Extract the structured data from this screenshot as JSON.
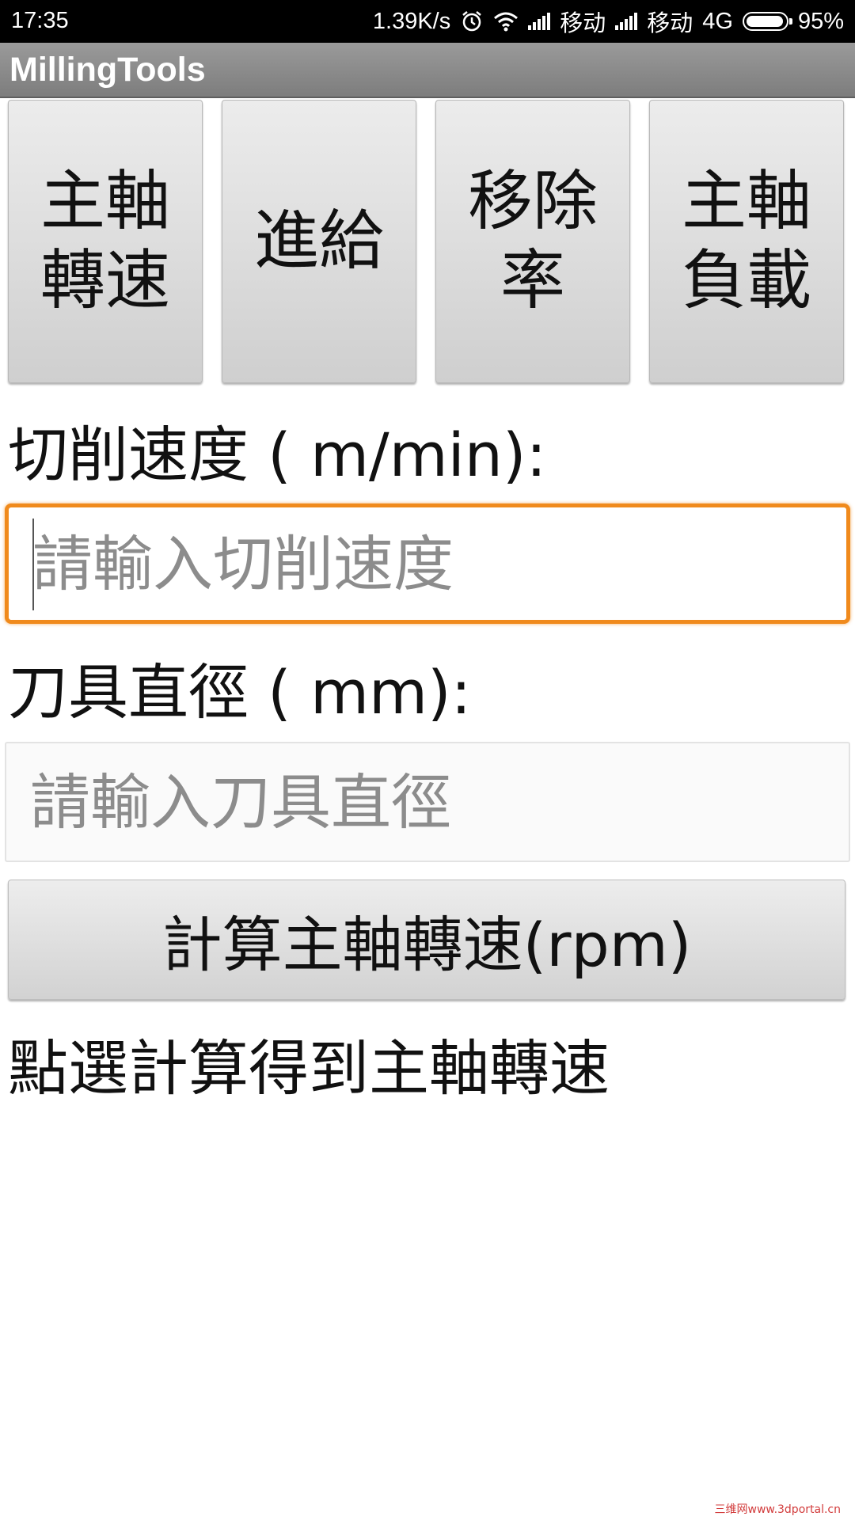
{
  "status_bar": {
    "time": "17:35",
    "net_speed": "1.39K/s",
    "carrier_1": "移动",
    "carrier_2": "移动",
    "network_type": "4G",
    "battery": "95%",
    "battery_level": 0.95
  },
  "app": {
    "title": "MillingTools"
  },
  "modes": [
    {
      "label": "主軸轉速"
    },
    {
      "label": "進給"
    },
    {
      "label": "移除率"
    },
    {
      "label": "主軸負載"
    }
  ],
  "cutting_speed": {
    "label": "切削速度 ( m/min):",
    "placeholder": "請輸入切削速度",
    "value": ""
  },
  "tool_diameter": {
    "label": "刀具直徑 ( mm):",
    "placeholder": "請輸入刀具直徑",
    "value": ""
  },
  "calculate_button": {
    "label": "計算主軸轉速(rpm)"
  },
  "result": {
    "text": "點選計算得到主軸轉速"
  },
  "watermark": {
    "text": "三维网www.3dportal.cn"
  }
}
